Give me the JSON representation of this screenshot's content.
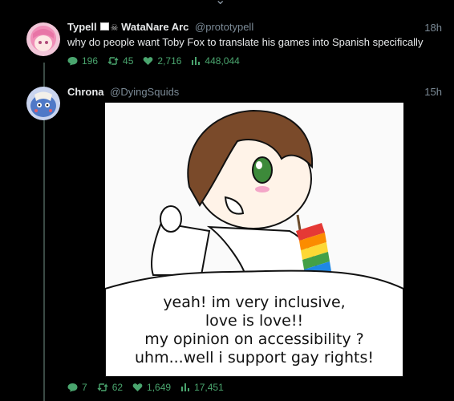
{
  "tweets": [
    {
      "name": "Typell",
      "name_suffix": "WataNare Arc",
      "handle": "@prototypell",
      "time": "18h",
      "text": "why do people want Toby Fox to translate his games into Spanish specifically",
      "replies": "196",
      "retweets": "45",
      "likes": "2,716",
      "views": "448,044"
    },
    {
      "name": "Chrona",
      "handle": "@DyingSquids",
      "time": "15h",
      "replies": "7",
      "retweets": "62",
      "likes": "1,649",
      "views": "17,451",
      "image": {
        "caption_lines": [
          "yeah! im very inclusive,",
          "love is love!!",
          "my opinion on accessibility ?",
          "uhm...well i support gay rights!"
        ]
      }
    }
  ],
  "colors": {
    "accent": "#4aa56e",
    "muted": "#7b8a96",
    "background": "#000000"
  }
}
